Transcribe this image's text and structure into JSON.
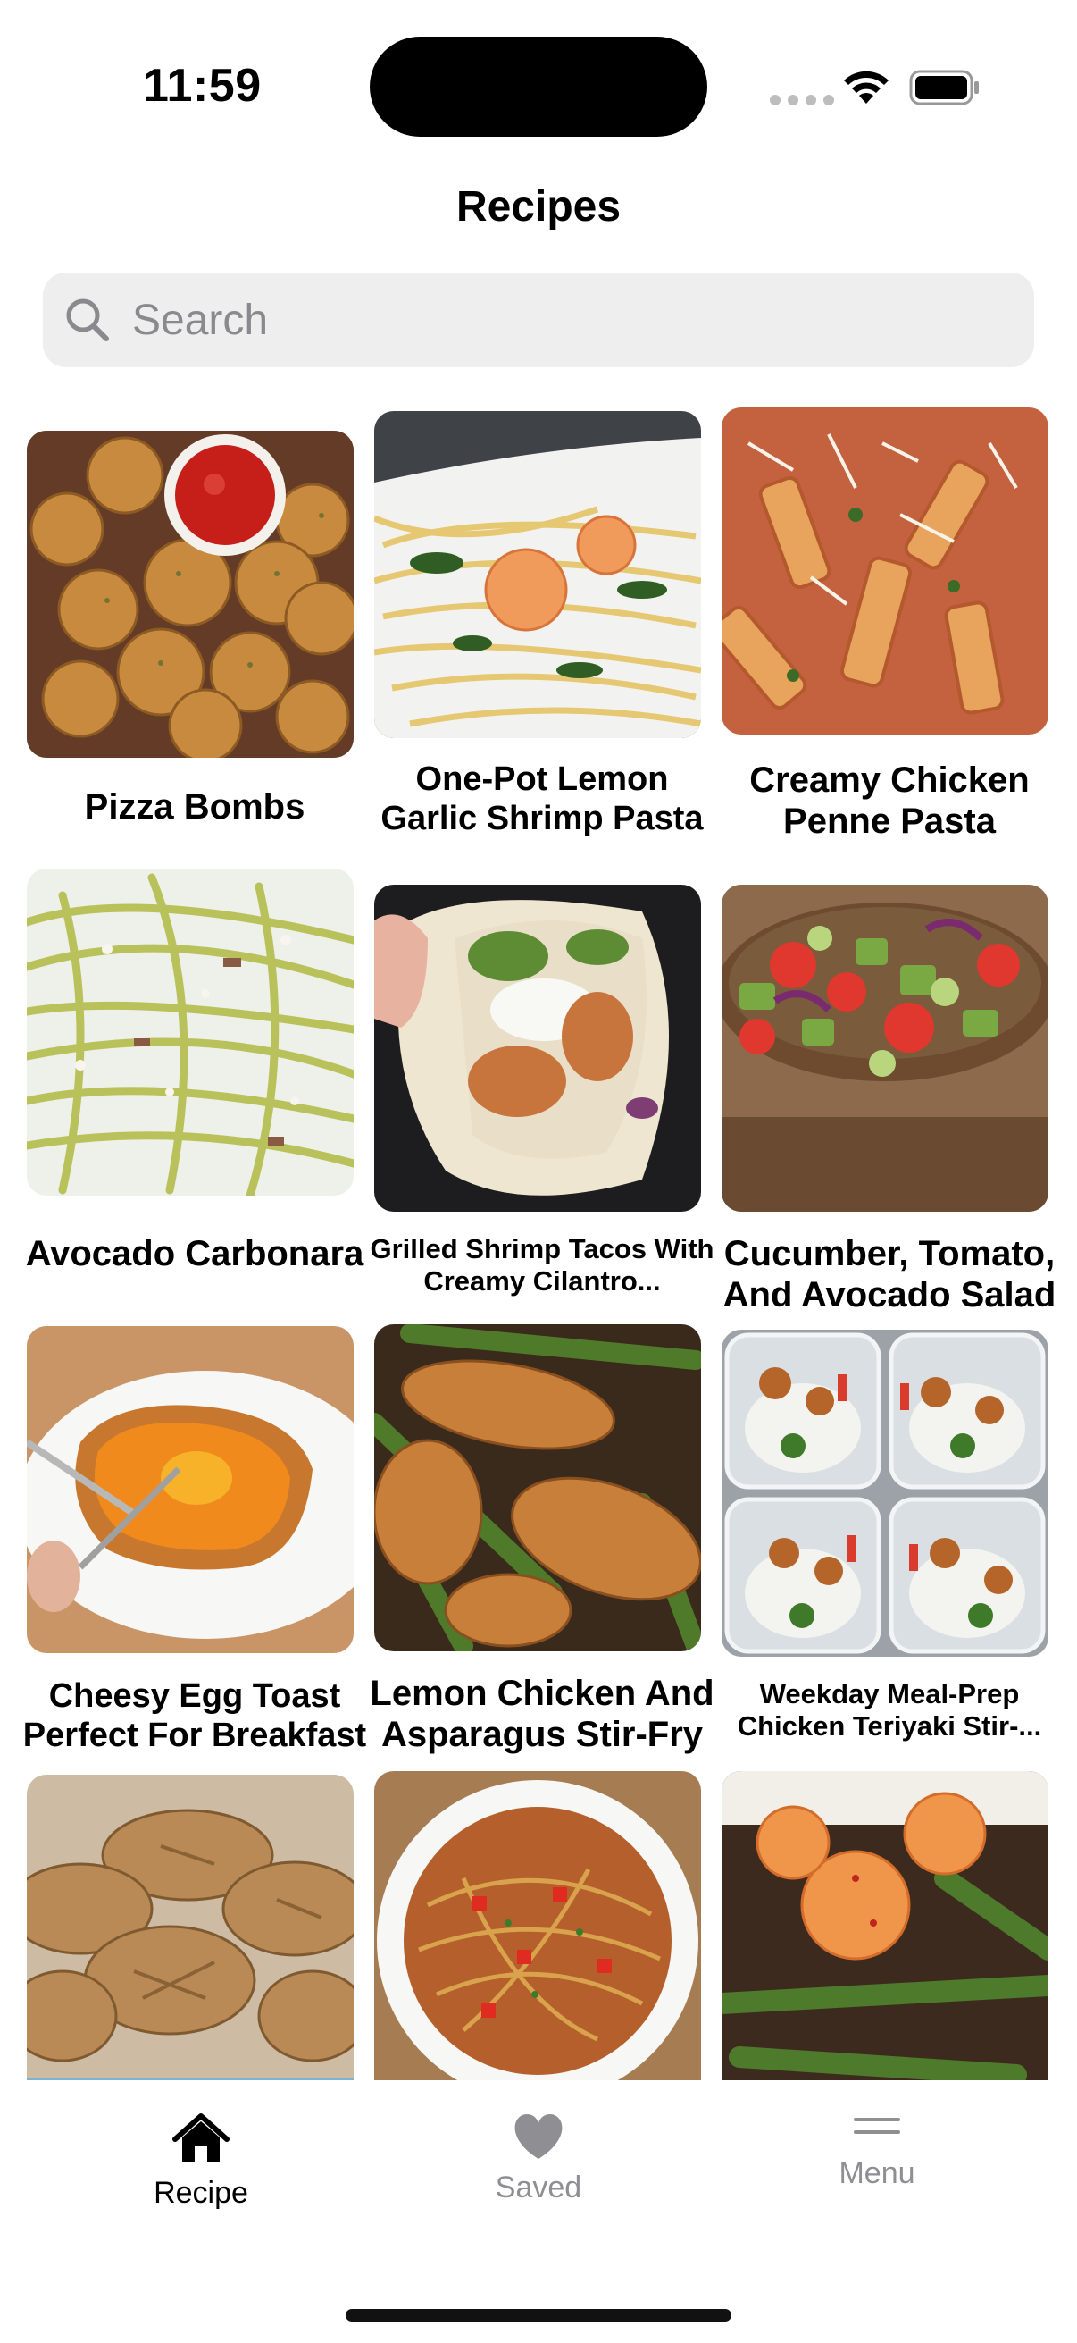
{
  "status_bar": {
    "time": "11:59"
  },
  "header": {
    "title": "Recipes"
  },
  "search": {
    "placeholder": "Search",
    "value": ""
  },
  "recipes": [
    {
      "title": "Pizza Bombs",
      "image": "pizza-bombs-photo"
    },
    {
      "title": "One-Pot Lemon Garlic Shrimp Pasta",
      "image": "shrimp-pasta-photo"
    },
    {
      "title": "Creamy Chicken Penne Pasta",
      "image": "penne-pasta-photo"
    },
    {
      "title": "Avocado Carbonara",
      "image": "avocado-carbonara-photo"
    },
    {
      "title": "Grilled Shrimp Tacos With Creamy Cilantro...",
      "image": "shrimp-tacos-photo"
    },
    {
      "title": "Cucumber, Tomato, And Avocado Salad",
      "image": "salad-photo"
    },
    {
      "title": "Cheesy Egg Toast Perfect For Breakfast",
      "image": "egg-toast-photo"
    },
    {
      "title": "Lemon Chicken And Asparagus Stir-Fry",
      "image": "chicken-asparagus-photo"
    },
    {
      "title": "Weekday Meal-Prep Chicken Teriyaki Stir-...",
      "image": "meal-prep-photo"
    },
    {
      "title": "",
      "image": "cookies-photo"
    },
    {
      "title": "",
      "image": "spaghetti-bowl-photo"
    },
    {
      "title": "",
      "image": "shrimp-asparagus-photo"
    }
  ],
  "tabbar": {
    "tabs": [
      {
        "label": "Recipe",
        "icon": "house-icon",
        "active": true
      },
      {
        "label": "Saved",
        "icon": "heart-icon",
        "active": false
      },
      {
        "label": "Menu",
        "icon": "hamburger-menu-icon",
        "active": false
      }
    ]
  },
  "colors": {
    "active_tab": "#000000",
    "inactive_tab": "#8e8e93",
    "search_background": "#eeeeef"
  }
}
